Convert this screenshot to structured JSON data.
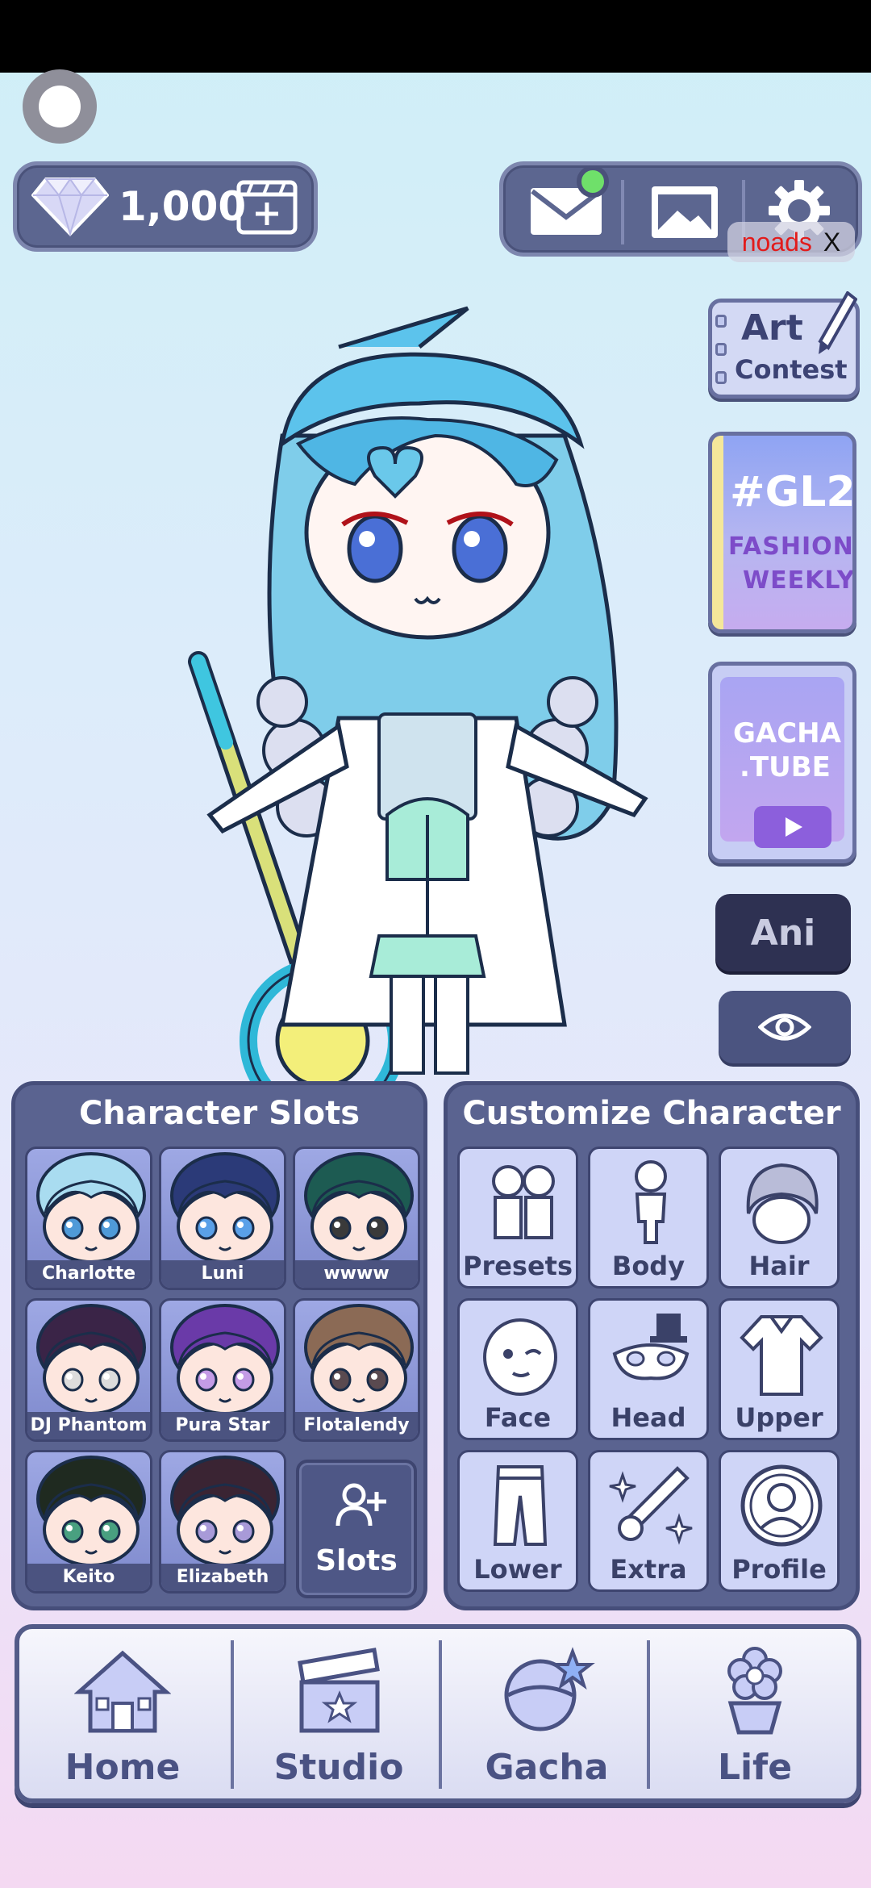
{
  "currency": {
    "gems": "1,000"
  },
  "ads": {
    "noads_label": "noads",
    "close_label": "X"
  },
  "side": {
    "art_contest_line1": "Art",
    "art_contest_line2": "Contest",
    "gl2_title": "#GL2",
    "gl2_line1": "FASHION",
    "gl2_line2": "WEEKLY",
    "gachatube_line1": "GACHA",
    "gachatube_line2": ".TUBE",
    "ani_label": "Ani"
  },
  "slots": {
    "title": "Character Slots",
    "characters": [
      {
        "name": "Charlotte",
        "hair": "#a9dcf0",
        "eyes": "#4f9ad8"
      },
      {
        "name": "Luni",
        "hair": "#2b3a78",
        "eyes": "#5aa0e8"
      },
      {
        "name": "wwww",
        "hair": "#1d5b52",
        "eyes": "#3a3a3a"
      },
      {
        "name": "DJ Phantom",
        "hair": "#3a2447",
        "eyes": "#dcdcdc"
      },
      {
        "name": "Pura Star",
        "hair": "#6a3aa8",
        "eyes": "#c39be6"
      },
      {
        "name": "Flotalendy",
        "hair": "#8b6a55",
        "eyes": "#5a4a50"
      },
      {
        "name": "Keito",
        "hair": "#1f2a20",
        "eyes": "#49a080"
      },
      {
        "name": "Elizabeth",
        "hair": "#3a2433",
        "eyes": "#a89ad8"
      }
    ],
    "add_label": "Slots"
  },
  "customize": {
    "title": "Customize Character",
    "items": [
      {
        "label": "Presets",
        "icon": "presets-icon"
      },
      {
        "label": "Body",
        "icon": "body-icon"
      },
      {
        "label": "Hair",
        "icon": "hair-icon"
      },
      {
        "label": "Face",
        "icon": "face-icon"
      },
      {
        "label": "Head",
        "icon": "head-icon"
      },
      {
        "label": "Upper",
        "icon": "upper-icon"
      },
      {
        "label": "Lower",
        "icon": "lower-icon"
      },
      {
        "label": "Extra",
        "icon": "extra-icon"
      },
      {
        "label": "Profile",
        "icon": "profile-icon"
      }
    ]
  },
  "nav": {
    "items": [
      {
        "label": "Home"
      },
      {
        "label": "Studio"
      },
      {
        "label": "Gacha"
      },
      {
        "label": "Life"
      }
    ]
  }
}
